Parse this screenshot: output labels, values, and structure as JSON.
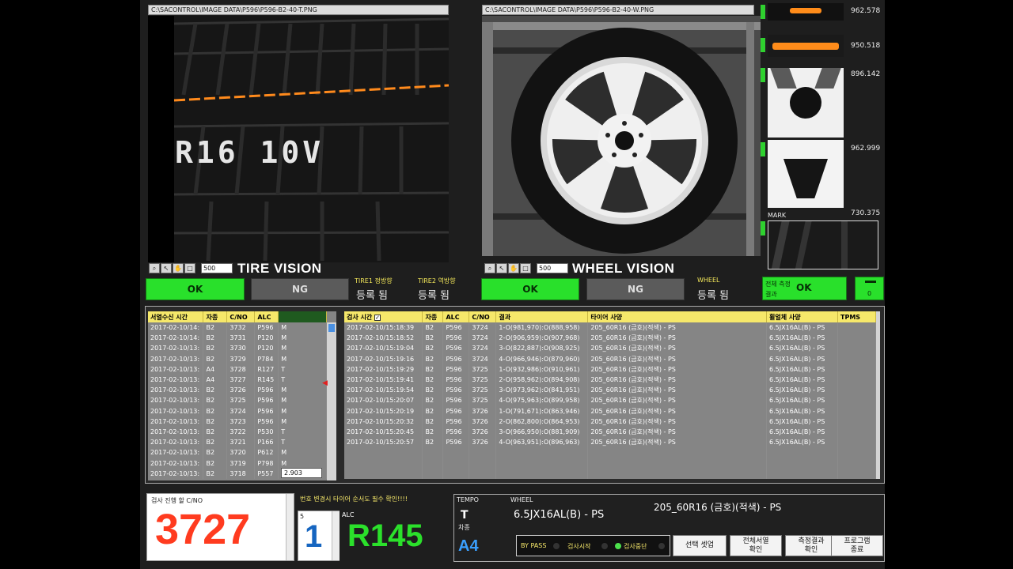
{
  "tire_panel": {
    "path": "C:\\SACONTROL\\IMAGE DATA\\P596\\P596-B2-40-T.PNG",
    "title": "TIRE VISION",
    "zoom": "500",
    "tire_text": "R16 10V"
  },
  "wheel_panel": {
    "path": "C:\\SACONTROL\\IMAGE DATA\\P596\\P596-B2-40-W.PNG",
    "title": "WHEEL VISION",
    "zoom": "500"
  },
  "thumbs": {
    "values": [
      "962.578",
      "950.518",
      "896.142",
      "962.999",
      "730.375"
    ],
    "mark_label": "MARK"
  },
  "status": {
    "tire_ok": "OK",
    "tire_ng": "NG",
    "tire1_label": "TIRE1 정방향",
    "tire1_value": "등록 됨",
    "tire2_label": "TIRE2 역방향",
    "tire2_value": "등록 됨",
    "wheel_ok": "OK",
    "wheel_ng": "NG",
    "wheel_label": "WHEEL",
    "wheel_value": "등록 됨",
    "overall_label_1": "전체 측정",
    "overall_label_2": "결과",
    "overall_value": "OK",
    "counter": "0"
  },
  "orders": {
    "headers": [
      "서열수신 시간",
      "자종",
      "C/NO",
      "ALC",
      ""
    ],
    "rows": [
      [
        "2017-02-10/14:",
        "B2",
        "3732",
        "P596",
        "M"
      ],
      [
        "2017-02-10/14:",
        "B2",
        "3731",
        "P120",
        "M"
      ],
      [
        "2017-02-10/13:",
        "B2",
        "3730",
        "P120",
        "M"
      ],
      [
        "2017-02-10/13:",
        "B2",
        "3729",
        "P784",
        "M"
      ],
      [
        "2017-02-10/13:",
        "A4",
        "3728",
        "R127",
        "T"
      ],
      [
        "2017-02-10/13:",
        "A4",
        "3727",
        "R145",
        "T"
      ],
      [
        "2017-02-10/13:",
        "B2",
        "3726",
        "P596",
        "M"
      ],
      [
        "2017-02-10/13:",
        "B2",
        "3725",
        "P596",
        "M"
      ],
      [
        "2017-02-10/13:",
        "B2",
        "3724",
        "P596",
        "M"
      ],
      [
        "2017-02-10/13:",
        "B2",
        "3723",
        "P596",
        "M"
      ],
      [
        "2017-02-10/13:",
        "B2",
        "3722",
        "P530",
        "T"
      ],
      [
        "2017-02-10/13:",
        "B2",
        "3721",
        "P166",
        "T"
      ],
      [
        "2017-02-10/13:",
        "B2",
        "3720",
        "P612",
        "M"
      ],
      [
        "2017-02-10/13:",
        "B2",
        "3719",
        "P798",
        "M"
      ],
      [
        "2017-02-10/13:",
        "B2",
        "3718",
        "P557",
        ""
      ]
    ],
    "tooltip": "2.903"
  },
  "results": {
    "headers": [
      "검사 시간",
      "자종",
      "ALC",
      "C/NO",
      "결과",
      "타이어 사양",
      "휠얼체 사양",
      "TPMS"
    ],
    "rows": [
      [
        "2017-02-10/15:18:39",
        "B2",
        "P596",
        "3724",
        "1-O(981,970):O(888,958)",
        "205_60R16 (금호)(적색) - PS",
        "6.5JX16AL(B) - PS",
        ""
      ],
      [
        "2017-02-10/15:18:52",
        "B2",
        "P596",
        "3724",
        "2-O(906,959):O(907,968)",
        "205_60R16 (금호)(적색) - PS",
        "6.5JX16AL(B) - PS",
        ""
      ],
      [
        "2017-02-10/15:19:04",
        "B2",
        "P596",
        "3724",
        "3-O(822,887):O(908,925)",
        "205_60R16 (금호)(적색) - PS",
        "6.5JX16AL(B) - PS",
        ""
      ],
      [
        "2017-02-10/15:19:16",
        "B2",
        "P596",
        "3724",
        "4-O(966,946):O(879,960)",
        "205_60R16 (금호)(적색) - PS",
        "6.5JX16AL(B) - PS",
        ""
      ],
      [
        "2017-02-10/15:19:29",
        "B2",
        "P596",
        "3725",
        "1-O(932,986):O(910,961)",
        "205_60R16 (금호)(적색) - PS",
        "6.5JX16AL(B) - PS",
        ""
      ],
      [
        "2017-02-10/15:19:41",
        "B2",
        "P596",
        "3725",
        "2-O(958,962):O(894,908)",
        "205_60R16 (금호)(적색) - PS",
        "6.5JX16AL(B) - PS",
        ""
      ],
      [
        "2017-02-10/15:19:54",
        "B2",
        "P596",
        "3725",
        "3-O(973,962):O(841,951)",
        "205_60R16 (금호)(적색) - PS",
        "6.5JX16AL(B) - PS",
        ""
      ],
      [
        "2017-02-10/15:20:07",
        "B2",
        "P596",
        "3725",
        "4-O(975,963):O(899,958)",
        "205_60R16 (금호)(적색) - PS",
        "6.5JX16AL(B) - PS",
        ""
      ],
      [
        "2017-02-10/15:20:19",
        "B2",
        "P596",
        "3726",
        "1-O(791,671):O(863,946)",
        "205_60R16 (금호)(적색) - PS",
        "6.5JX16AL(B) - PS",
        ""
      ],
      [
        "2017-02-10/15:20:32",
        "B2",
        "P596",
        "3726",
        "2-O(862,800):O(864,953)",
        "205_60R16 (금호)(적색) - PS",
        "6.5JX16AL(B) - PS",
        ""
      ],
      [
        "2017-02-10/15:20:45",
        "B2",
        "P596",
        "3726",
        "3-O(966,950):O(881,909)",
        "205_60R16 (금호)(적색) - PS",
        "6.5JX16AL(B) - PS",
        ""
      ],
      [
        "2017-02-10/15:20:57",
        "B2",
        "P596",
        "3726",
        "4-O(963,951):O(896,963)",
        "205_60R16 (금호)(적색) - PS",
        "6.5JX16AL(B) - PS",
        ""
      ]
    ]
  },
  "bottom": {
    "cno_label": "검사 진행 할  C/NO",
    "cno_value": "3727",
    "seq_small": "5",
    "seq_value": "1",
    "notice": "번호 변경시 타이어 순서도 필수 확인!!!!",
    "alc_label": "ALC",
    "alc_value": "R145",
    "tempo_label": "TEMPO",
    "tempo_value": "T",
    "car_label": "차종",
    "car_value": "A4",
    "wheel_label": "WHEEL",
    "wheel_value": "6.5JX16AL(B) - PS",
    "tire_spec": "205_60R16 (금호)(적색) - PS",
    "bypass": "BY PASS",
    "start": "검사시작",
    "stop": "검사중단",
    "btn_select": "선택 셋업",
    "btn_order_1": "전체서열",
    "btn_order_2": "확인",
    "btn_result_1": "측정결과",
    "btn_result_2": "확인",
    "btn_exit_1": "프로그램",
    "btn_exit_2": "종료"
  },
  "colors": {
    "ok_green": "#29e02b",
    "alc_green": "#2be02b",
    "cno_red": "#ff3b1f",
    "header_yellow": "#f6e86a",
    "seq_blue": "#1565c0",
    "car_blue": "#3aa0ff"
  }
}
